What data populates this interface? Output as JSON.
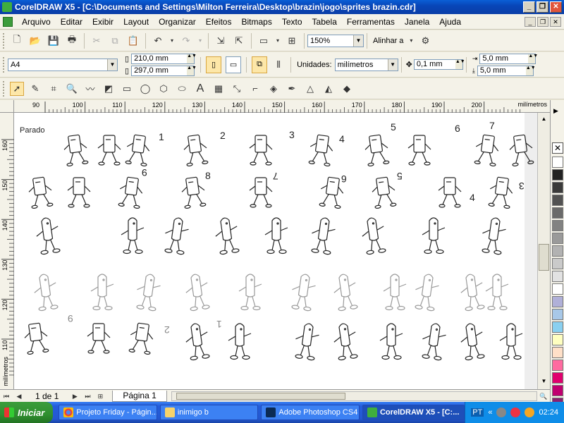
{
  "window": {
    "title": "CorelDRAW X5 - [C:\\Documents and Settings\\Milton Ferreira\\Desktop\\brazin\\jogo\\sprites brazin.cdr]",
    "controls": [
      "_",
      "❐",
      "✕"
    ]
  },
  "menu": {
    "items": [
      "Arquivo",
      "Editar",
      "Exibir",
      "Layout",
      "Organizar",
      "Efeitos",
      "Bitmaps",
      "Texto",
      "Tabela",
      "Ferramentas",
      "Janela",
      "Ajuda"
    ],
    "doc_controls": [
      "_",
      "❐",
      "✕"
    ]
  },
  "standard_toolbar": {
    "zoom": "150%",
    "align_label": "Alinhar a"
  },
  "property_bar": {
    "page_size": "A4",
    "width": "210,0 mm",
    "height": "297,0 mm",
    "units_label": "Unidades:",
    "units_value": "milímetros",
    "nudge": "0,1 mm",
    "dup_x": "5,0 mm",
    "dup_y": "5,0 mm"
  },
  "rulers": {
    "unit": "milímetros",
    "h_ticks": [
      "90",
      "100",
      "110",
      "120",
      "130",
      "140",
      "150",
      "160",
      "170",
      "180",
      "190",
      "200"
    ],
    "v_ticks": [
      "160",
      "150",
      "140",
      "130",
      "120",
      "110"
    ]
  },
  "canvas": {
    "parado_label": "Parado",
    "labels": [
      "1",
      "2",
      "3",
      "4",
      "5",
      "6",
      "7",
      "9",
      "8",
      "7",
      "6",
      "5",
      "4",
      "3",
      "9",
      "2",
      "1"
    ]
  },
  "status": {
    "page_count": "1 de 1",
    "page_tab": "Página 1"
  },
  "taskbar": {
    "start": "Iniciar",
    "tasks": [
      "Projeto Friday - Págin...",
      "inimigo b",
      "Adobe Photoshop CS4",
      "CorelDRAW X5 - [C:..."
    ],
    "tray_lang": "PT",
    "clock": "02:24"
  },
  "palette_colors": [
    "#ffffff",
    "#222222",
    "#3a3a3a",
    "#525252",
    "#6a6a6a",
    "#828282",
    "#9a9a9a",
    "#b2b2b2",
    "#cacaca",
    "#e2e2e2",
    "#ffffff",
    "#b0b0d8",
    "#a8c8e8",
    "#8ad0f0",
    "#ffffc0",
    "#ffe0c8",
    "#ff6aa0",
    "#e0006e",
    "#c00070",
    "#8b2070"
  ]
}
